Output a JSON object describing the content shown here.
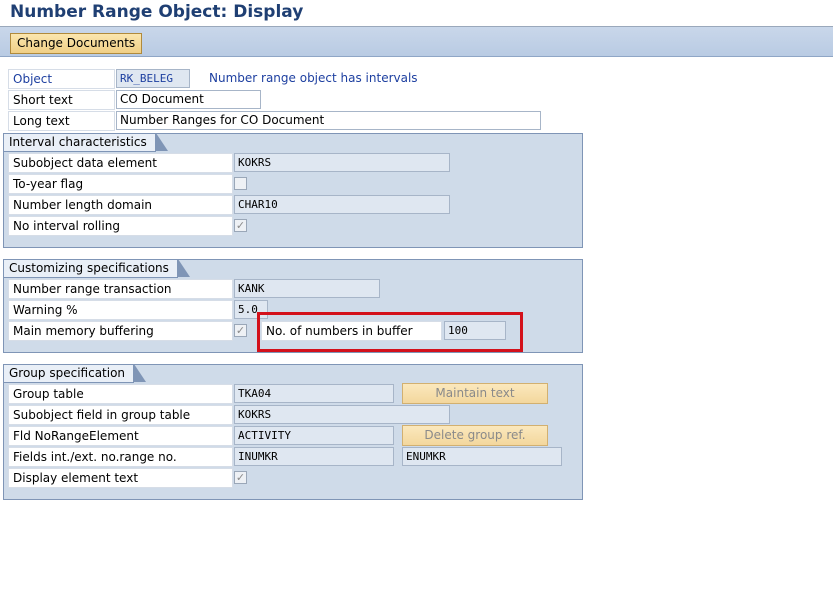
{
  "window": {
    "title": "Number Range Object: Display"
  },
  "toolbar": {
    "change_documents_label": "Change Documents"
  },
  "header": {
    "object_label": "Object",
    "object_value": "RK_BELEG",
    "object_note": "Number range object has intervals",
    "short_text_label": "Short text",
    "short_text_value": "CO Document",
    "long_text_label": "Long text",
    "long_text_value": "Number Ranges for CO Document"
  },
  "interval": {
    "title": "Interval characteristics",
    "subobject_label": "Subobject data element",
    "subobject_value": "KOKRS",
    "to_year_label": "To-year flag",
    "to_year_checked": false,
    "length_domain_label": "Number length domain",
    "length_domain_value": "CHAR10",
    "no_rolling_label": "No interval rolling",
    "no_rolling_checked": true
  },
  "customizing": {
    "title": "Customizing specifications",
    "transaction_label": "Number range transaction",
    "transaction_value": "KANK",
    "warning_label": "Warning %",
    "warning_value": "5.0",
    "buffering_label": "Main memory buffering",
    "buffering_checked": true,
    "buffer_count_label": "No. of numbers in buffer",
    "buffer_count_value": "100"
  },
  "group": {
    "title": "Group specification",
    "group_table_label": "Group table",
    "group_table_value": "TKA04",
    "maintain_text_label": "Maintain text",
    "subobject_field_label": "Subobject field in group table",
    "subobject_field_value": "KOKRS",
    "norange_label": "Fld  NoRangeElement",
    "norange_value": "ACTIVITY",
    "delete_ref_label": "Delete group ref.",
    "fields_label": "Fields int./ext. no.range no.",
    "fields_int_value": "INUMKR",
    "fields_ext_value": "ENUMKR",
    "display_text_label": "Display element text",
    "display_text_checked": true
  },
  "colors": {
    "title": "#1f3f73",
    "group_bg": "#cfdbe9",
    "highlight": "#d3111b"
  },
  "icons": {
    "checkmark": "✓"
  }
}
